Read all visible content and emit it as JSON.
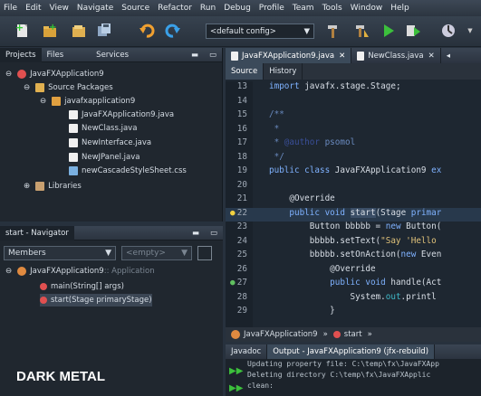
{
  "menu": [
    "File",
    "Edit",
    "View",
    "Navigate",
    "Source",
    "Refactor",
    "Run",
    "Debug",
    "Profile",
    "Team",
    "Tools",
    "Window",
    "Help"
  ],
  "toolbar": {
    "config": "<default config>"
  },
  "projects": {
    "tabs": [
      "Projects",
      "Files",
      "Services"
    ],
    "tree": [
      "JavaFXApplication9",
      "Source Packages",
      "javafxapplication9",
      "JavaFXApplication9.java",
      "NewClass.java",
      "NewInterface.java",
      "NewJPanel.java",
      "newCascadeStyleSheet.css",
      "Libraries"
    ]
  },
  "navigator": {
    "title": "start - Navigator",
    "filter": "Members",
    "empty": "<empty>",
    "root": "JavaFXApplication9",
    "root_suffix": " :: Application",
    "method1": "main(String[] args)",
    "method2": "start(Stage primaryStage)"
  },
  "watermark": "DARK METAL",
  "editor": {
    "tabs": [
      "JavaFXApplication9.java",
      "NewClass.java"
    ],
    "subtabs": [
      "Source",
      "History"
    ],
    "breadcrumb": [
      "JavaFXApplication9",
      "start"
    ],
    "lines": [
      {
        "n": "13",
        "t": "import javafx.stage.Stage;"
      },
      {
        "n": "14",
        "t": ""
      },
      {
        "n": "15",
        "t": "/**"
      },
      {
        "n": "16",
        "t": " *"
      },
      {
        "n": "17",
        "t": " * @author psomol"
      },
      {
        "n": "18",
        "t": " */"
      },
      {
        "n": "19",
        "t": "public class JavaFXApplication9 ex"
      },
      {
        "n": "20",
        "t": ""
      },
      {
        "n": "21",
        "t": "    @Override"
      },
      {
        "n": "22",
        "t": "    public void start(Stage primar"
      },
      {
        "n": "23",
        "t": "        Button bbbbb = new Button("
      },
      {
        "n": "24",
        "t": "        bbbbb.setText(\"Say 'Hello "
      },
      {
        "n": "25",
        "t": "        bbbbb.setOnAction(new Even"
      },
      {
        "n": "26",
        "t": "            @Override"
      },
      {
        "n": "27",
        "t": "            public void handle(Act"
      },
      {
        "n": "28",
        "t": "                System.out.printl"
      },
      {
        "n": "29",
        "t": "            }"
      }
    ]
  },
  "output": {
    "tabs": [
      "Javadoc",
      "Output - JavaFXApplication9 (jfx-rebuild)"
    ],
    "lines": [
      "Updating property file: C:\\temp\\fx\\JavaFXApp",
      "Deleting directory C:\\temp\\fx\\JavaFXApplic",
      "clean:"
    ]
  }
}
